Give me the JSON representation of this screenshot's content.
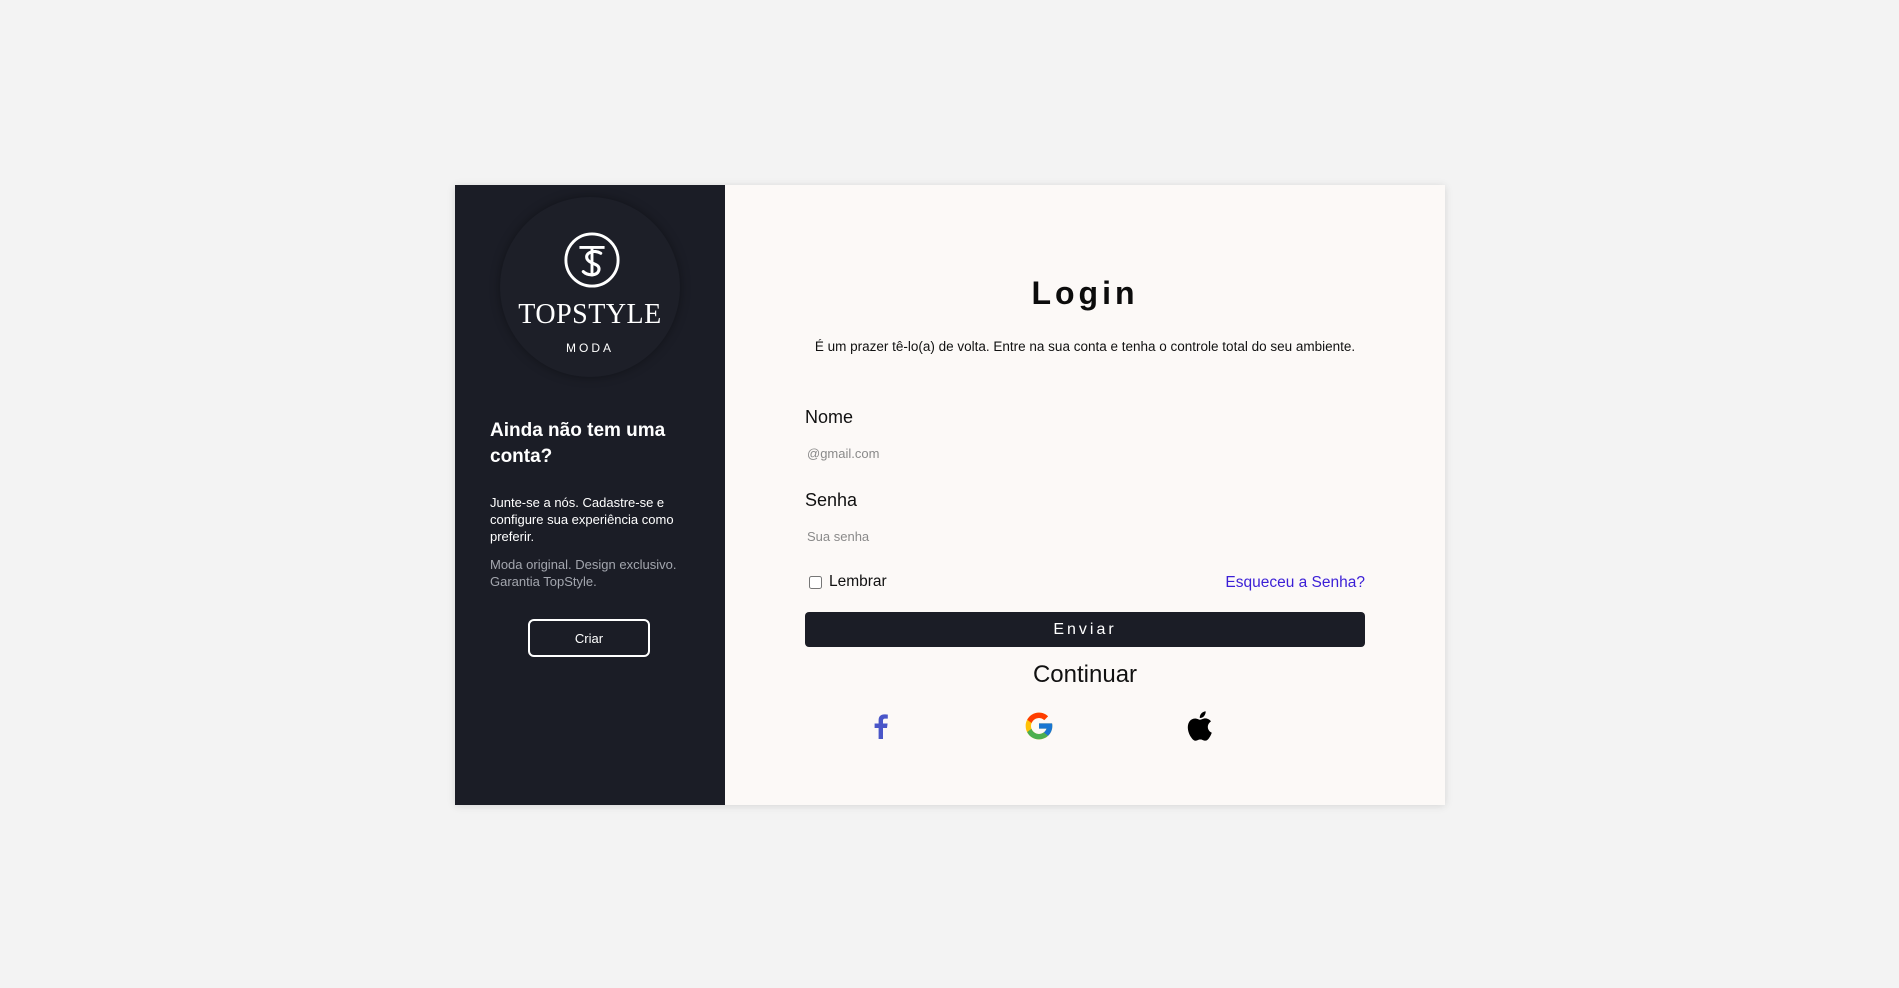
{
  "brand": {
    "name": "TOPSTYLE",
    "subtitle": "MODA"
  },
  "signup": {
    "title": "Ainda não tem uma conta?",
    "text": "Junte-se a nós. Cadastre-se e configure sua experiência como preferir.",
    "tagline": "Moda original. Design exclusivo. Garantia TopStyle.",
    "button_label": "Criar"
  },
  "login": {
    "title": "Login",
    "subtitle": "É um prazer tê-lo(a) de volta. Entre na sua conta e tenha o controle total do seu ambiente.",
    "name_label": "Nome",
    "name_placeholder": "@gmail.com",
    "password_label": "Senha",
    "password_placeholder": "Sua senha",
    "remember_label": "Lembrar",
    "forgot_link": "Esqueceu a Senha?",
    "submit_label": "Enviar",
    "continue_label": "Continuar"
  },
  "social": [
    {
      "icon": "facebook-icon",
      "color": "#4a56c8"
    },
    {
      "icon": "google-icon",
      "color": "#4285f4"
    },
    {
      "icon": "apple-icon",
      "color": "#000000"
    }
  ],
  "colors": {
    "dark_panel": "#1b1d26",
    "form_background": "#fcf9f7",
    "page_background": "#f3f3f3",
    "link": "#3b1fd6"
  }
}
